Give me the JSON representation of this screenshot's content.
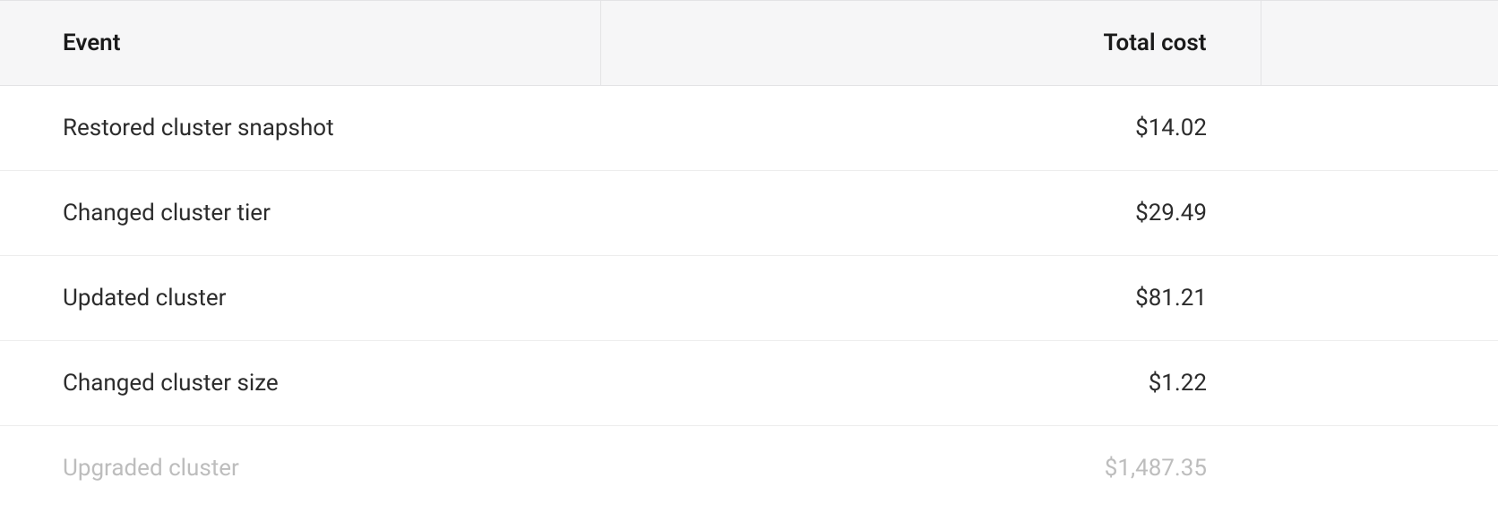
{
  "table": {
    "headers": {
      "event": "Event",
      "total_cost": "Total cost"
    },
    "rows": [
      {
        "event": "Restored cluster snapshot",
        "cost": "$14.02"
      },
      {
        "event": "Changed cluster tier",
        "cost": "$29.49"
      },
      {
        "event": "Updated cluster",
        "cost": "$81.21"
      },
      {
        "event": "Changed cluster size",
        "cost": "$1.22"
      },
      {
        "event": "Upgraded cluster",
        "cost": "$1,487.35"
      }
    ]
  }
}
